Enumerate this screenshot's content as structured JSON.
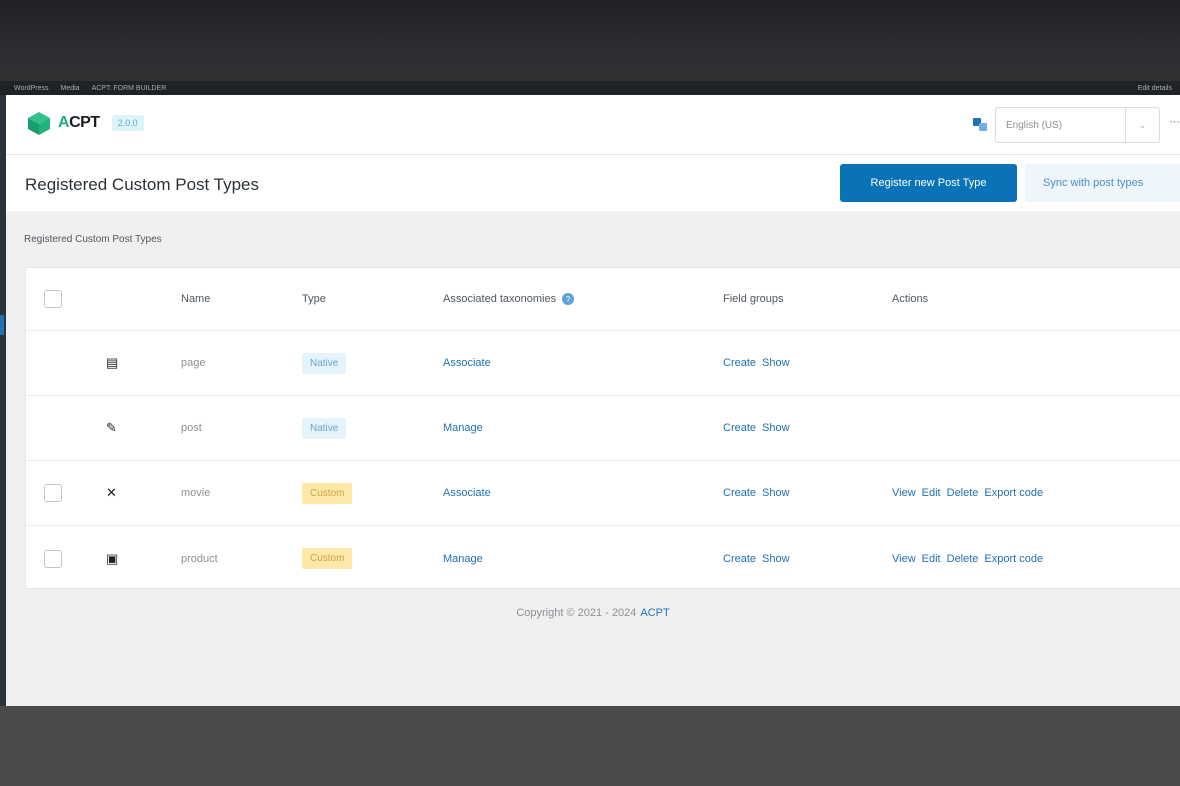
{
  "admin_bar": {
    "items": [
      "WordPress",
      "",
      "",
      "",
      "Media",
      "ACPT: FORM BUILDER"
    ],
    "right": "Edit details"
  },
  "header_bar": {
    "logo": {
      "prefix": "A",
      "rest": "CPT"
    },
    "version": "2.0.0",
    "language": {
      "value": "English (US)"
    }
  },
  "page": {
    "title": "Registered Custom Post Types",
    "register_button": "Register new Post Type",
    "sync_button": "Sync with post types",
    "section_label": "Registered Custom Post Types"
  },
  "table": {
    "columns": {
      "name": "Name",
      "type": "Type",
      "taxonomies": "Associated taxonomies",
      "field_groups": "Field groups",
      "actions": "Actions"
    },
    "rows": [
      {
        "icon": "▤",
        "icon_name": "page-icon",
        "name": "page",
        "type": "Native",
        "taxonomy_action": "Associate",
        "field_groups": [
          "Create",
          "Show"
        ],
        "actions": [],
        "checkbox": false
      },
      {
        "icon": "✎",
        "icon_name": "pin-icon",
        "name": "post",
        "type": "Native",
        "taxonomy_action": "Manage",
        "field_groups": [
          "Create",
          "Show"
        ],
        "actions": [],
        "checkbox": false
      },
      {
        "icon": "✕",
        "icon_name": "movie-icon",
        "name": "movie",
        "type": "Custom",
        "taxonomy_action": "Associate",
        "field_groups": [
          "Create",
          "Show"
        ],
        "actions": [
          "View",
          "Edit",
          "Delete",
          "Export code"
        ],
        "checkbox": true
      },
      {
        "icon": "▣",
        "icon_name": "product-icon",
        "name": "product",
        "type": "Custom",
        "taxonomy_action": "Manage",
        "field_groups": [
          "Create",
          "Show"
        ],
        "actions": [
          "View",
          "Edit",
          "Delete",
          "Export code"
        ],
        "checkbox": true
      }
    ]
  },
  "footer": {
    "copyright": "Copyright © 2021 - 2024",
    "brand": "ACPT"
  }
}
